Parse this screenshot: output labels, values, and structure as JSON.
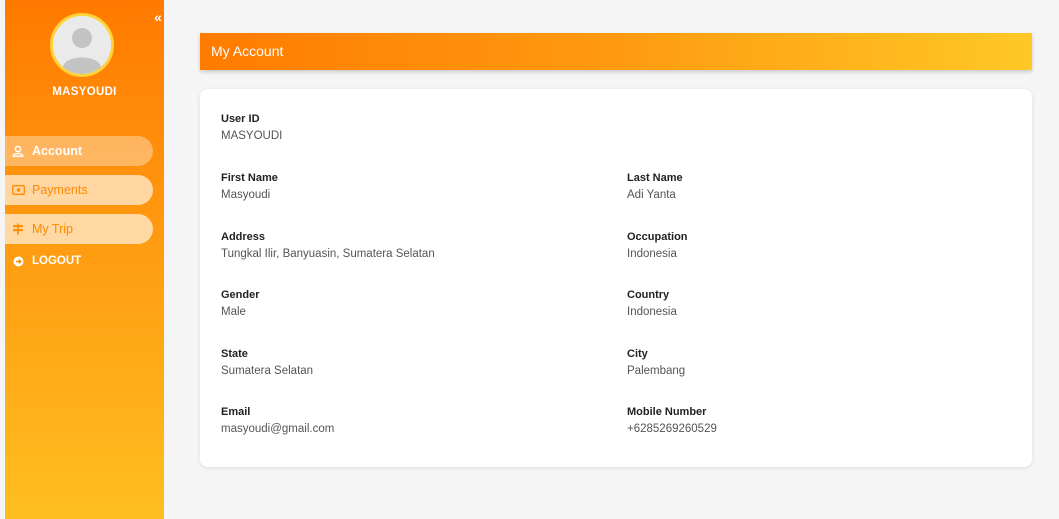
{
  "sidebar": {
    "username": "MASYOUDI",
    "collapse_icon": "double-chevron-left-icon",
    "items": [
      {
        "label": "Account",
        "icon": "user-icon",
        "active": true
      },
      {
        "label": "Payments",
        "icon": "cash-icon",
        "active": false
      },
      {
        "label": "My Trip",
        "icon": "signpost-icon",
        "active": false
      },
      {
        "label": "LOGOUT",
        "icon": "logout-icon",
        "active": false
      }
    ]
  },
  "header": {
    "title": "My Account"
  },
  "account": {
    "user_id": {
      "label": "User ID",
      "value": "MASYOUDI"
    },
    "first_name": {
      "label": "First Name",
      "value": "Masyoudi"
    },
    "last_name": {
      "label": "Last Name",
      "value": "Adi Yanta"
    },
    "address": {
      "label": "Address",
      "value": "Tungkal Ilir, Banyuasin, Sumatera Selatan"
    },
    "occupation": {
      "label": "Occupation",
      "value": "Indonesia"
    },
    "gender": {
      "label": "Gender",
      "value": "Male"
    },
    "country": {
      "label": "Country",
      "value": "Indonesia"
    },
    "state": {
      "label": "State",
      "value": "Sumatera Selatan"
    },
    "city": {
      "label": "City",
      "value": "Palembang"
    },
    "email": {
      "label": "Email",
      "value": "masyoudi@gmail.com"
    },
    "mobile": {
      "label": "Mobile Number",
      "value": "+6285269260529"
    }
  },
  "colors": {
    "accent": "#ff8a00",
    "accent_light": "#ffc825",
    "background": "#f5f5f6"
  }
}
